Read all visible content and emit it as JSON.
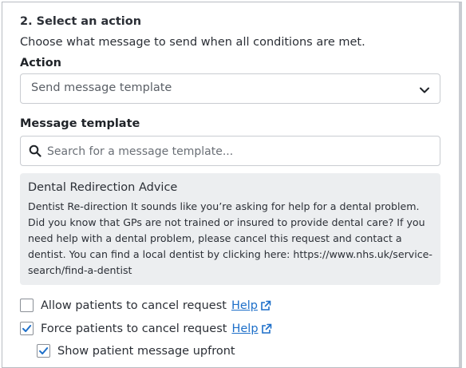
{
  "section": {
    "title": "2. Select an action",
    "description": "Choose what message to send when all conditions are met."
  },
  "action": {
    "label": "Action",
    "selected": "Send message template",
    "icon": "chevron-down-icon"
  },
  "message_template": {
    "label": "Message template",
    "search_placeholder": "Search for a message template...",
    "search_value": "",
    "search_icon": "search-icon"
  },
  "template_preview": {
    "title": "Dental Redirection Advice",
    "body": "Dentist Re-direction It sounds like you’re asking for help for a dental problem. Did you know that GPs are not trained or insured to provide dental care? If you need help with a dental problem, please cancel this request and contact a dentist. You can find a local dentist by clicking here: https://www.nhs.uk/service-search/find-a-dentist"
  },
  "options": [
    {
      "label": "Allow patients to cancel request",
      "checked": false,
      "help": "Help"
    },
    {
      "label": "Force patients to cancel request",
      "checked": true,
      "help": "Help"
    },
    {
      "label": "Show patient message upfront",
      "checked": true
    }
  ],
  "colors": {
    "link": "#1d6fc9",
    "check": "#1d6fc9",
    "card_bg": "#eceef0"
  }
}
